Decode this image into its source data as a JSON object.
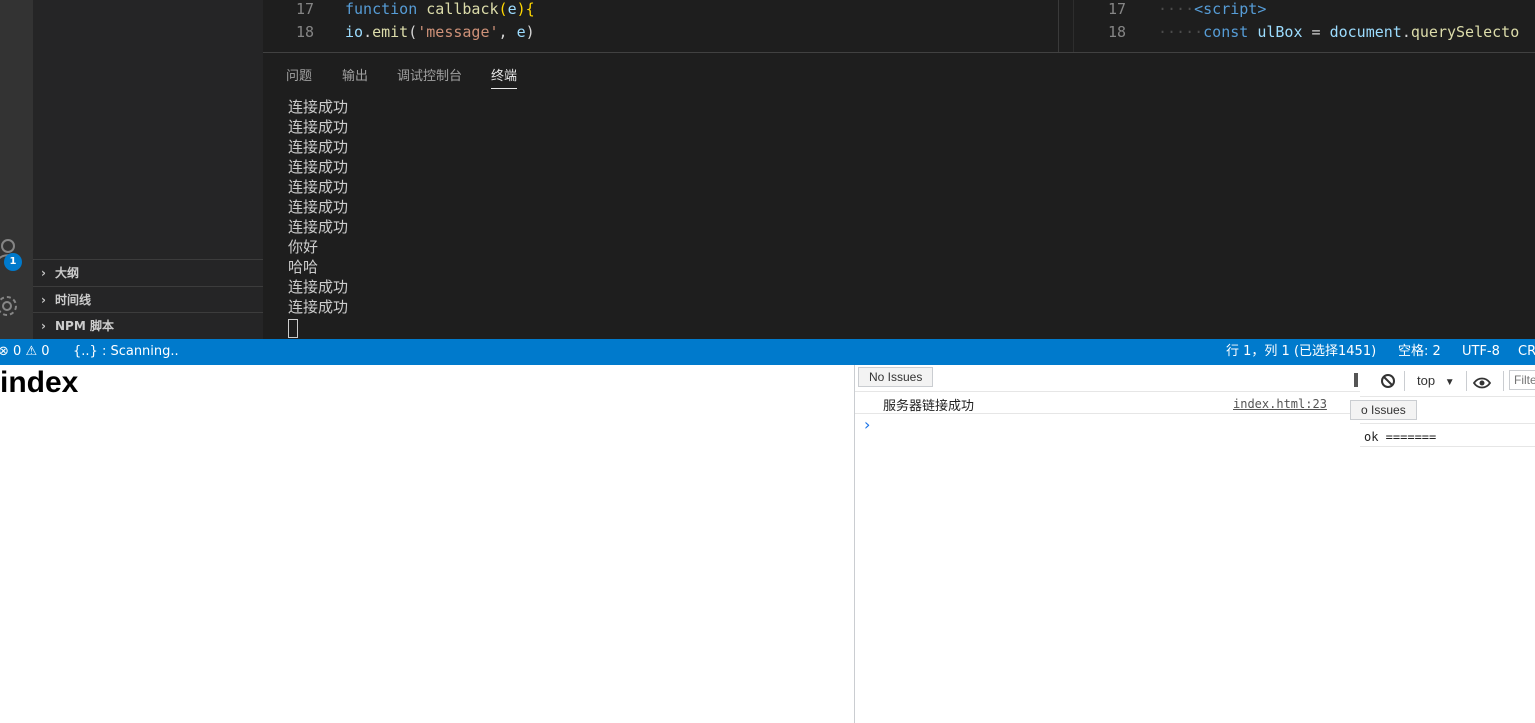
{
  "editor_left": {
    "lines": [
      {
        "num": "17",
        "parts": [
          [
            "kw",
            "function "
          ],
          [
            "fn",
            "callback"
          ],
          [
            "brace",
            "("
          ],
          [
            "var",
            "e"
          ],
          [
            "brace",
            ")"
          ],
          [
            "brace",
            "{"
          ]
        ]
      },
      {
        "num": "18",
        "parts": [
          [
            "var",
            "io"
          ],
          [
            "plain",
            "."
          ],
          [
            "fn",
            "emit"
          ],
          [
            "plain",
            "("
          ],
          [
            "str",
            "'message'"
          ],
          [
            "plain",
            ", "
          ],
          [
            "var",
            "e"
          ],
          [
            "plain",
            ")"
          ]
        ]
      }
    ]
  },
  "editor_right": {
    "lines": [
      {
        "num": "17",
        "parts": [
          [
            "dots",
            "····"
          ],
          [
            "tag",
            "<script>"
          ]
        ]
      },
      {
        "num": "18",
        "parts": [
          [
            "dots",
            "·····"
          ],
          [
            "kw",
            "const "
          ],
          [
            "var",
            "ulBox "
          ],
          [
            "plain",
            "= "
          ],
          [
            "var",
            "document"
          ],
          [
            "plain",
            "."
          ],
          [
            "fn",
            "querySelecto"
          ]
        ]
      }
    ]
  },
  "sidebar": {
    "sections": [
      "大纲",
      "时间线",
      "NPM 脚本"
    ],
    "badge": "1"
  },
  "panel": {
    "tabs": [
      {
        "label": "问题",
        "active": false
      },
      {
        "label": "输出",
        "active": false
      },
      {
        "label": "调试控制台",
        "active": false
      },
      {
        "label": "终端",
        "active": true
      }
    ],
    "terminal_lines": [
      "连接成功",
      "连接成功",
      "连接成功",
      "连接成功",
      "连接成功",
      "连接成功",
      "连接成功",
      "你好",
      "哈哈",
      "连接成功",
      "连接成功"
    ]
  },
  "status_bar": {
    "errors": "0",
    "warnings": "0",
    "scanning": "{..} : Scanning..",
    "position": "行 1，列 1 (已选择1451)",
    "spaces": "空格: 2",
    "encoding": "UTF-8",
    "eol": "CR"
  },
  "browser": {
    "heading": "index"
  },
  "devtools_main": {
    "issues_label": "No Issues",
    "log_message": "服务器链接成功",
    "log_source": "index.html:23",
    "prompt": "›"
  },
  "devtools_secondary": {
    "context": "top",
    "filter_placeholder": "Filte",
    "issues_label": "o Issues",
    "log_message": "ok ======="
  },
  "colors": {
    "status_bar": "#007acc",
    "panel_bg": "#1e1e1e",
    "sidebar_bg": "#252526",
    "activity_bar": "#333333"
  }
}
